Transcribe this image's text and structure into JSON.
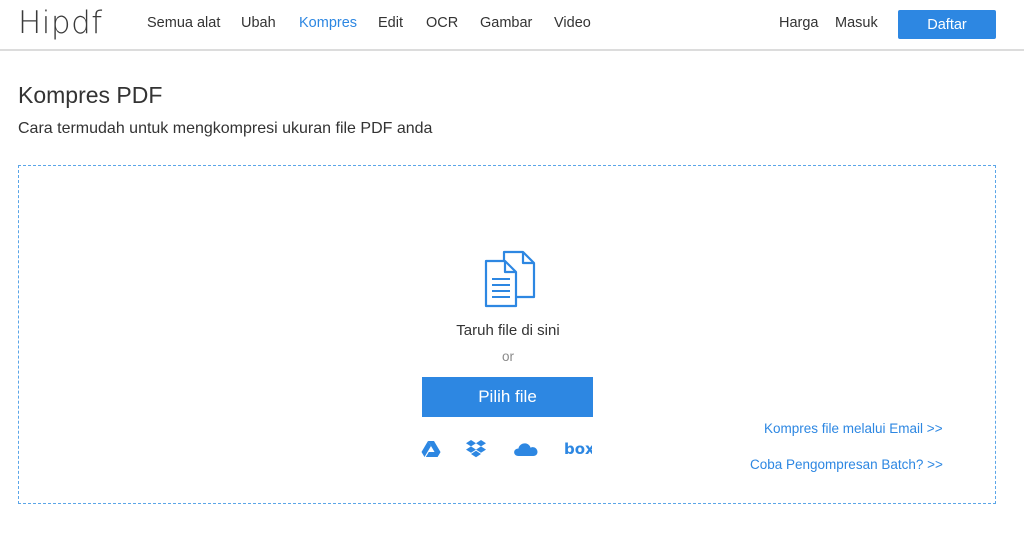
{
  "header": {
    "logo": "Hipdf",
    "nav": [
      {
        "label": "Semua alat",
        "active": false
      },
      {
        "label": "Ubah",
        "active": false
      },
      {
        "label": "Kompres",
        "active": true
      },
      {
        "label": "Edit",
        "active": false
      },
      {
        "label": "OCR",
        "active": false
      },
      {
        "label": "Gambar",
        "active": false
      },
      {
        "label": "Video",
        "active": false
      }
    ],
    "pricing_label": "Harga",
    "login_label": "Masuk",
    "signup_label": "Daftar"
  },
  "main": {
    "title": "Kompres PDF",
    "subtitle": "Cara termudah untuk mengkompresi ukuran file PDF anda",
    "dropzone": {
      "icon": "documents-icon",
      "drop_text": "Taruh file di sini",
      "or_text": "or",
      "choose_label": "Pilih file",
      "cloud_sources": [
        "google-drive-icon",
        "dropbox-icon",
        "onedrive-icon",
        "box-icon"
      ],
      "box_text": "box",
      "email_link": "Kompres file melalui Email >>",
      "batch_link": "Coba Pengompresan Batch? >>"
    }
  },
  "colors": {
    "accent": "#2d87e2",
    "text": "#333333",
    "muted": "#8a8a8a",
    "border": "#dcdcdc"
  }
}
